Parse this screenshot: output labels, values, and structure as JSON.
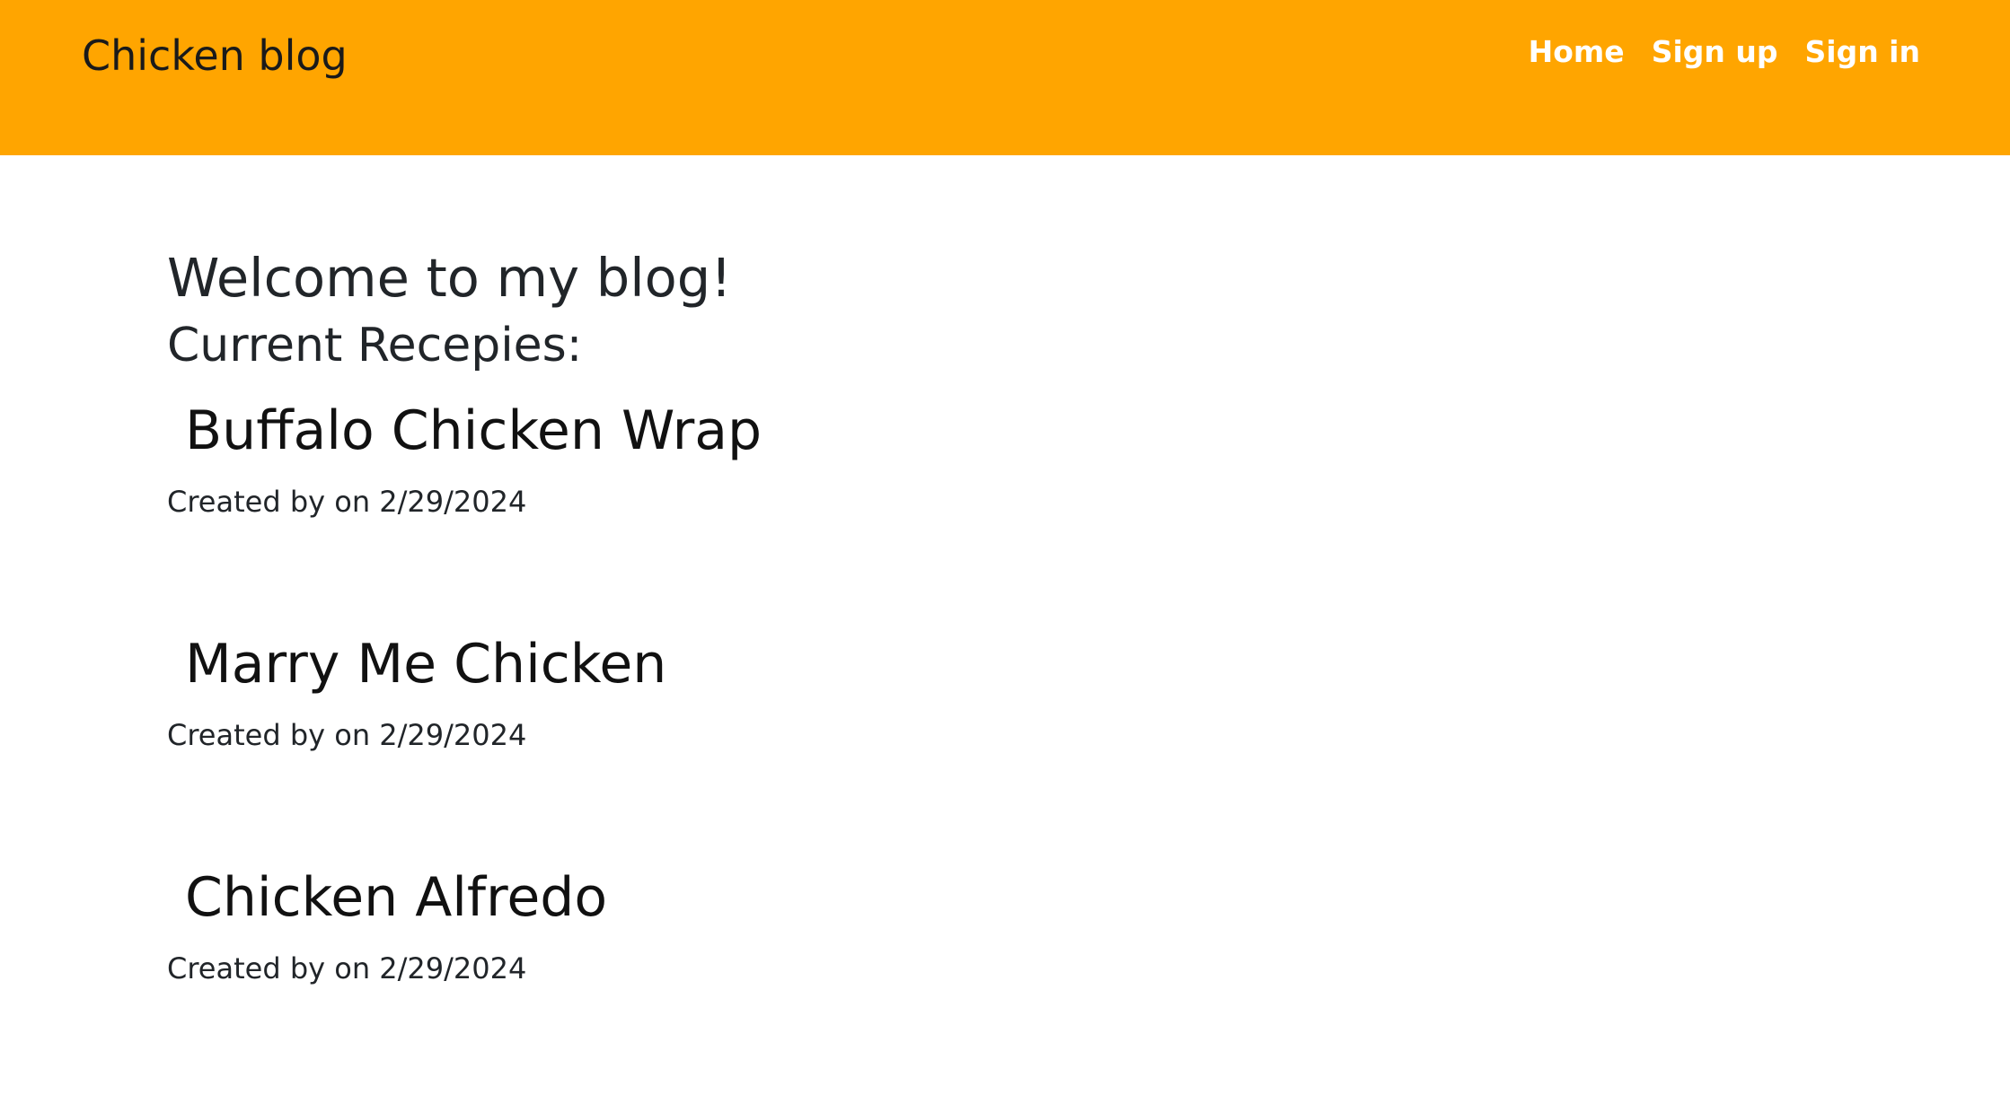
{
  "navbar": {
    "brand": "Chicken blog",
    "links": [
      "Home",
      "Sign up",
      "Sign in"
    ],
    "background": "#ffa500"
  },
  "main": {
    "welcome": "Welcome to my blog!",
    "subtitle": "Current Recepies:",
    "recipes": [
      {
        "title": "Buffalo Chicken Wrap",
        "meta": "Created by on 2/29/2024"
      },
      {
        "title": "Marry Me Chicken",
        "meta": "Created by on 2/29/2024"
      },
      {
        "title": "Chicken Alfredo",
        "meta": "Created by on 2/29/2024"
      }
    ]
  }
}
